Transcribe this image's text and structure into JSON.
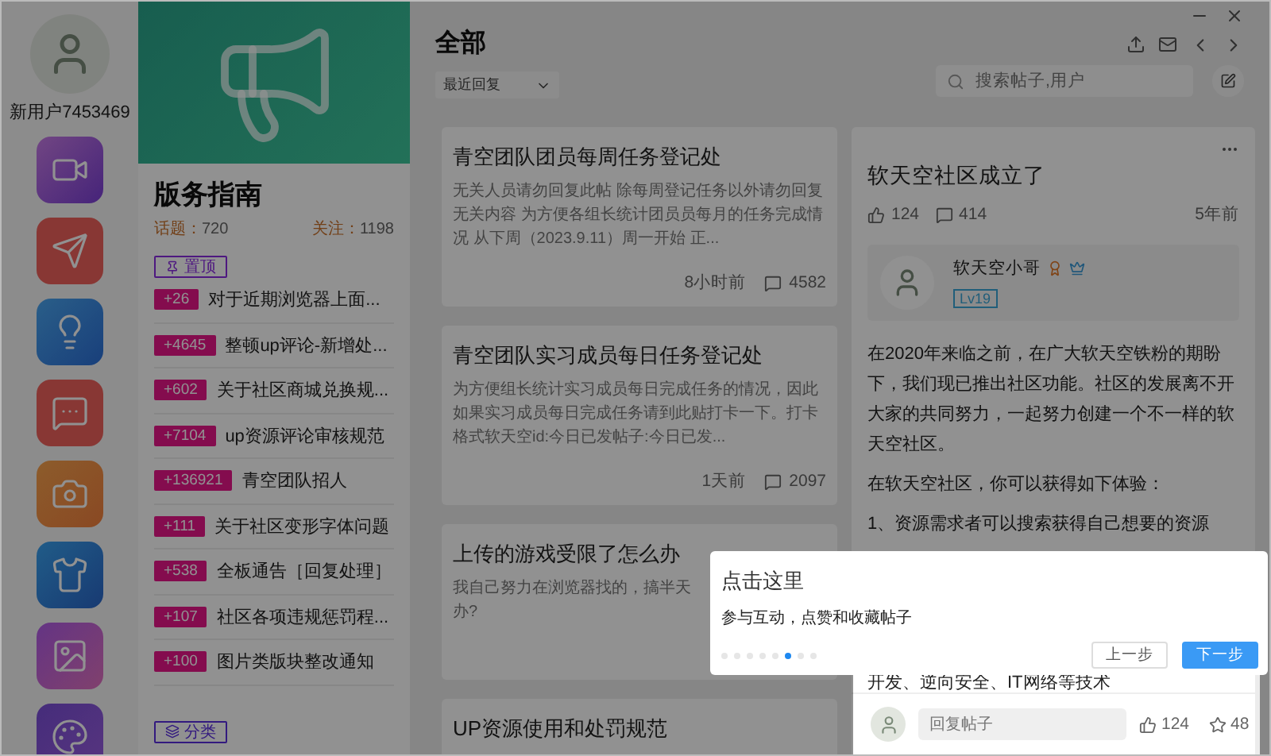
{
  "user": {
    "name": "新用户7453469"
  },
  "apps": [
    {
      "kind": "video"
    },
    {
      "kind": "send"
    },
    {
      "kind": "idea"
    },
    {
      "kind": "chat"
    },
    {
      "kind": "camera"
    },
    {
      "kind": "shirt"
    },
    {
      "kind": "image"
    },
    {
      "kind": "palette"
    }
  ],
  "board": {
    "title": "版务指南",
    "topics_label": "话题：",
    "topics": "720",
    "follows_label": "关注：",
    "follows": "1198",
    "pinned_label": "置顶",
    "category_label": "分类",
    "pinned": [
      {
        "count": "+26",
        "title": "对于近期浏览器上面..."
      },
      {
        "count": "+4645",
        "title": "整顿up评论-新增处..."
      },
      {
        "count": "+602",
        "title": "关于社区商城兑换规..."
      },
      {
        "count": "+7104",
        "title": "up资源评论审核规范"
      },
      {
        "count": "+136921",
        "title": "青空团队招人"
      },
      {
        "count": "+111",
        "title": "关于社区变形字体问题"
      },
      {
        "count": "+538",
        "title": "全板通告［回复处理］"
      },
      {
        "count": "+107",
        "title": "社区各项违规惩罚程..."
      },
      {
        "count": "+100",
        "title": "图片类版块整改通知"
      }
    ]
  },
  "feed": {
    "title": "全部",
    "sort": "最近回复",
    "posts": [
      {
        "title": "青空团队团员每周任务登记处",
        "body": [
          "无关人员请勿回复此帖 除每周登记任务以外请勿回复无关内容 为方便各组长统计团员员每月的任务完成情况 从下周（2023.9.11）周一开始 正..."
        ],
        "time": "8小时前",
        "comments": "4582"
      },
      {
        "title": "青空团队实习成员每日任务登记处",
        "body": [
          "为方便组长统计实习成员每日完成任务的情况，因此如果实习成员每日完成任务请到此贴打卡一下。打卡格式软天空id:今日已发帖子:今日已发..."
        ],
        "time": "1天前",
        "comments": "2097"
      },
      {
        "title": "上传的游戏受限了怎么办",
        "body": [
          "我自己努力在浏览器找的，搞半天",
          "办?"
        ]
      },
      {
        "title": "UP资源使用和处罚规范"
      }
    ]
  },
  "search": {
    "placeholder": "搜索帖子,用户"
  },
  "article": {
    "title": "软天空社区成立了",
    "likes": "124",
    "comments": "414",
    "age": "5年前",
    "author": {
      "name": "软天空小哥",
      "level": "Lv19"
    },
    "paragraphs": [
      "在2020年来临之前，在广大软天空铁粉的期盼下，我们现已推出社区功能。社区的发展离不开大家的共同努力，一起努力创建一个不一样的软天空社区。",
      "在软天空社区，你可以获得如下体验：",
      "1、资源需求者可以搜索获得自己想要的资源",
      "开发、逆向安全、IT网络等技术"
    ],
    "reply": {
      "placeholder": "回复帖子",
      "likes": "124",
      "stars": "48"
    }
  },
  "tour": {
    "title": "点击这里",
    "text": "参与互动，点赞和收藏帖子",
    "prev": "上一步",
    "next": "下一步",
    "steps": [
      {
        "selected": false
      },
      {
        "selected": false
      },
      {
        "selected": false
      },
      {
        "selected": false
      },
      {
        "selected": false
      },
      {
        "selected": true
      },
      {
        "selected": false
      },
      {
        "selected": false
      }
    ]
  }
}
